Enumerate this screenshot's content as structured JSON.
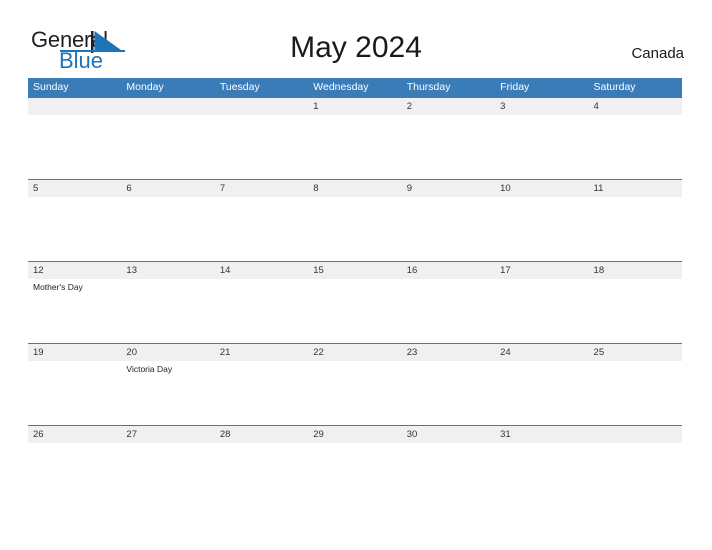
{
  "brand": {
    "word_one": "General",
    "word_two": "Blue",
    "flag_icon": "blue-triangle-flag-icon"
  },
  "header": {
    "title": "May 2024",
    "region": "Canada"
  },
  "colors": {
    "header_blue": "#3a7cb8",
    "band_gray": "#f0f0f0",
    "brand_blue": "#1f73b7",
    "text_dark": "#1a1a1a"
  },
  "calendar": {
    "weekdays": [
      "Sunday",
      "Monday",
      "Tuesday",
      "Wednesday",
      "Thursday",
      "Friday",
      "Saturday"
    ],
    "weeks": [
      {
        "days": [
          {
            "num": "",
            "event": ""
          },
          {
            "num": "",
            "event": ""
          },
          {
            "num": "",
            "event": ""
          },
          {
            "num": "1",
            "event": ""
          },
          {
            "num": "2",
            "event": ""
          },
          {
            "num": "3",
            "event": ""
          },
          {
            "num": "4",
            "event": ""
          }
        ]
      },
      {
        "days": [
          {
            "num": "5",
            "event": ""
          },
          {
            "num": "6",
            "event": ""
          },
          {
            "num": "7",
            "event": ""
          },
          {
            "num": "8",
            "event": ""
          },
          {
            "num": "9",
            "event": ""
          },
          {
            "num": "10",
            "event": ""
          },
          {
            "num": "11",
            "event": ""
          }
        ]
      },
      {
        "days": [
          {
            "num": "12",
            "event": "Mother's Day"
          },
          {
            "num": "13",
            "event": ""
          },
          {
            "num": "14",
            "event": ""
          },
          {
            "num": "15",
            "event": ""
          },
          {
            "num": "16",
            "event": ""
          },
          {
            "num": "17",
            "event": ""
          },
          {
            "num": "18",
            "event": ""
          }
        ]
      },
      {
        "days": [
          {
            "num": "19",
            "event": ""
          },
          {
            "num": "20",
            "event": "Victoria Day"
          },
          {
            "num": "21",
            "event": ""
          },
          {
            "num": "22",
            "event": ""
          },
          {
            "num": "23",
            "event": ""
          },
          {
            "num": "24",
            "event": ""
          },
          {
            "num": "25",
            "event": ""
          }
        ]
      },
      {
        "days": [
          {
            "num": "26",
            "event": ""
          },
          {
            "num": "27",
            "event": ""
          },
          {
            "num": "28",
            "event": ""
          },
          {
            "num": "29",
            "event": ""
          },
          {
            "num": "30",
            "event": ""
          },
          {
            "num": "31",
            "event": ""
          },
          {
            "num": "",
            "event": ""
          }
        ]
      }
    ]
  }
}
